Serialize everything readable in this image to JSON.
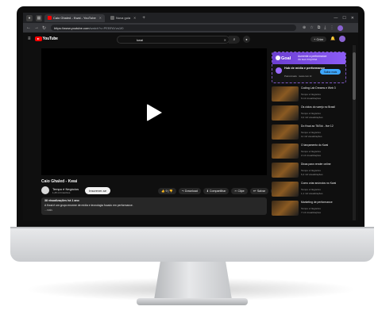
{
  "browser": {
    "tabs": [
      {
        "label": "Caio Ghaled - Kwai - YouTube",
        "active": true
      },
      {
        "label": "Nova guia",
        "active": false
      }
    ],
    "url_host": "https://www.youtube.com",
    "url_path": "/watch?v=PEBFAYzs1f0"
  },
  "youtube": {
    "logo_text": "YouTube",
    "search_query": "kwai",
    "create_label": "+ Criar"
  },
  "video": {
    "title": "Caio Ghaled - Kwai",
    "channel": "Tempo é Negócios",
    "subscribers": "1,25 mil inscritos",
    "subscribe_label": "Inscrever-se",
    "actions": [
      "👍 9  |  👎",
      "↪ Download",
      "⬇ Compartilhar",
      "✂ Clipe",
      "≡+ Salvar",
      "⋯"
    ],
    "views_line": "38 visualizações  há 1 ano",
    "description": "A Kwai é um grupo enorme de mídia e tecnologia focado em performance.",
    "more_label": "...mais"
  },
  "ad": {
    "brand": "Goal",
    "tagline": "Aumente a performance",
    "tagline_sub": "da sua empresa",
    "headline": "Hub de mídia e performance",
    "sponsor": "Patrocinado · kwai.com.br",
    "cta": "Saiba mais"
  },
  "related": [
    {
      "title": "Coding Lab Dreams e Web 3",
      "meta": "Tempo é Negócios",
      "stats": "6 mil visualizações"
    },
    {
      "title": "Os ciclos do varejo no Brasil",
      "meta": "Tempo é Negócios",
      "stats": "3,2 mil visualizações"
    },
    {
      "title": "Do Kwai ao TikTok - live 12",
      "meta": "Tempo é Negócios",
      "stats": "11 mil visualizações"
    },
    {
      "title": "O lançamento do Kwai",
      "meta": "Tempo é Negócios",
      "stats": "2 mil visualizações"
    },
    {
      "title": "Dicas para vender online",
      "meta": "Tempo é Negócios",
      "stats": "6,4 mil visualizações"
    },
    {
      "title": "Como criar anúncios no Kwai",
      "meta": "Tempo é Negócios",
      "stats": "1,1 mil visualizações"
    },
    {
      "title": "Marketing de performance",
      "meta": "Tempo é Negócios",
      "stats": "7 mil visualizações"
    }
  ]
}
